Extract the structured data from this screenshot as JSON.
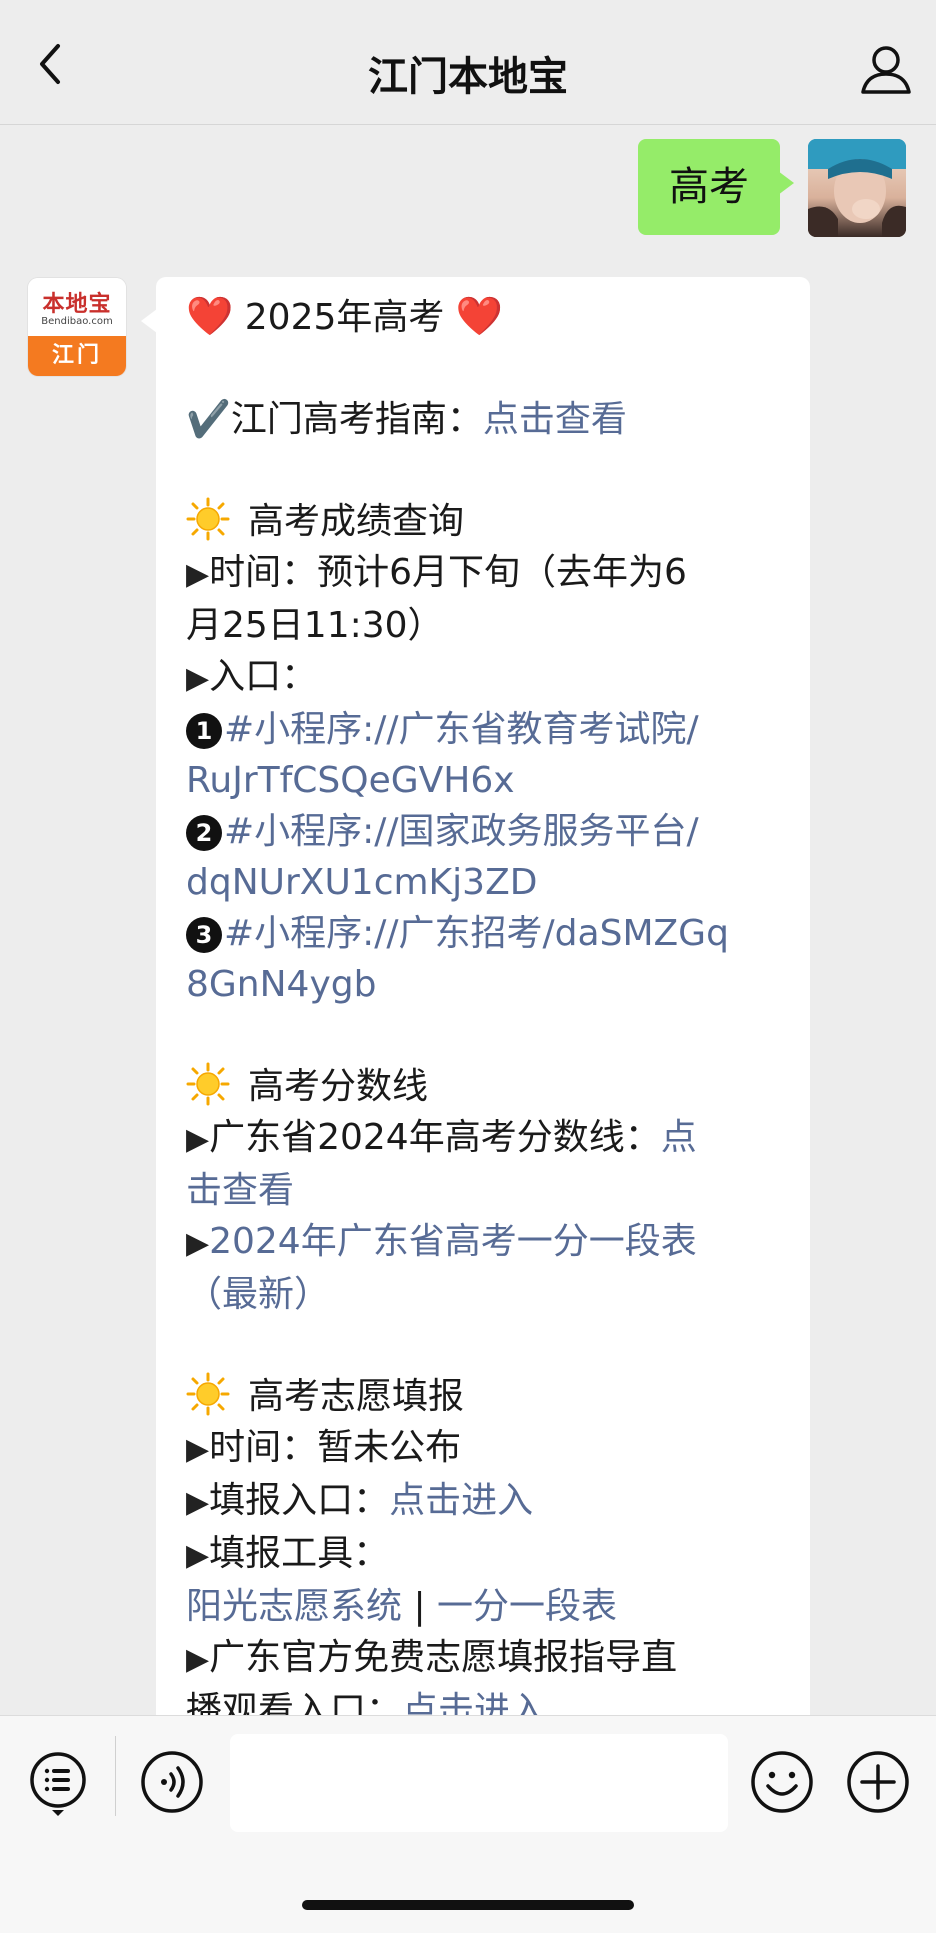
{
  "header": {
    "title": "江门本地宝",
    "back_icon": "chevron-left-icon",
    "profile_icon": "user-icon"
  },
  "chat": {
    "my_message": "高考",
    "bot_avatar": {
      "brand": "本地宝",
      "domain": "Bendibao.com",
      "city": "江门"
    },
    "bot_message": {
      "title_left_emoji": "❤️",
      "title": "2025年高考",
      "title_right_emoji": "❤️",
      "guide_check": "✔️",
      "guide_label": "江门高考指南：",
      "guide_link": "点击查看",
      "score_query": {
        "heading": "高考成绩查询",
        "time_label": "时间：",
        "time_value_1": "预计6月下旬（去年为6",
        "time_value_2": "月25日11:30）",
        "entry_label": "入口：",
        "entries": [
          {
            "num": "1",
            "line1": "#小程序://广东省教育考试院/",
            "line2": "RuJrTfCSQeGVH6x"
          },
          {
            "num": "2",
            "line1": "#小程序://国家政务服务平台/",
            "line2": "dqNUrXU1cmKj3ZD"
          },
          {
            "num": "3",
            "line1": "#小程序://广东招考/daSMZGq",
            "line2": "8GnN4ygb"
          }
        ]
      },
      "score_line": {
        "heading": "高考分数线",
        "item1_text": "广东省2024年高考分数线：",
        "item1_link_a": "点",
        "item1_link_b": "击查看",
        "item2_link_a": "2024年广东省高考一分一段表",
        "item2_link_b": "（最新）"
      },
      "application": {
        "heading": "高考志愿填报",
        "time_label": "时间：",
        "time_value": "暂未公布",
        "entry_label": "填报入口：",
        "entry_link": "点击进入",
        "tool_label": "填报工具：",
        "tool_link_1": "阳光志愿系统",
        "tool_sep": " | ",
        "tool_link_2": "一分一段表",
        "guide_text_1": "广东官方免费志愿填报指导直",
        "guide_text_2": "播观看入口：",
        "guide_link": "点击进入"
      }
    }
  },
  "input_bar": {
    "menu_icon": "menu-list-icon",
    "voice_icon": "voice-icon",
    "message_value": "",
    "emoji_icon": "emoji-icon",
    "plus_icon": "plus-icon"
  },
  "colors": {
    "link": "#576b95",
    "my_bubble": "#95ec69",
    "background": "#ededed"
  }
}
